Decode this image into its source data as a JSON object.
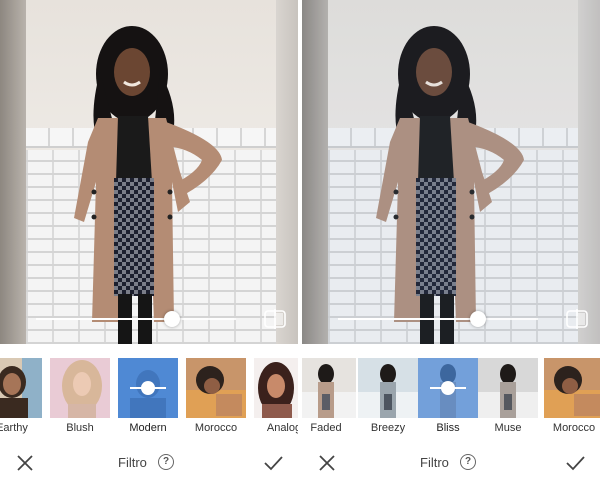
{
  "panels": [
    {
      "id": "left",
      "slider_value": 0.68,
      "filters": [
        {
          "label": "Earthy",
          "style": "earthy"
        },
        {
          "label": "Blush",
          "style": "blush"
        },
        {
          "label": "Modern",
          "style": "modern",
          "selected": true
        },
        {
          "label": "Morocco",
          "style": "morocco"
        },
        {
          "label": "Analog",
          "style": "analog"
        }
      ],
      "bottom_bar": {
        "title": "Filtro",
        "help_glyph": "?"
      }
    },
    {
      "id": "right",
      "slider_value": 0.7,
      "filters": [
        {
          "label": "Faded",
          "style": "faded"
        },
        {
          "label": "Breezy",
          "style": "breezy"
        },
        {
          "label": "Bliss",
          "style": "bliss",
          "selected": true
        },
        {
          "label": "Muse",
          "style": "muse"
        },
        {
          "label": "Morocco",
          "style": "morocco"
        }
      ],
      "bottom_bar": {
        "title": "Filtro",
        "help_glyph": "?"
      }
    }
  ],
  "icons": {
    "close": "close-icon",
    "apply": "checkmark-icon",
    "compare": "compare-icon",
    "help": "help-circle-icon"
  },
  "colors": {
    "selected_overlay": "#4a85d2",
    "text": "#333333"
  }
}
